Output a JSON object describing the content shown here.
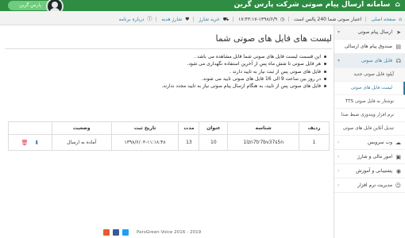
{
  "header": {
    "brand": "سامانه ارسال پیام صوتی شرکت پارس گرین",
    "user_label": "پارس گرین"
  },
  "crumbbar": {
    "home": "صفحه اصلی",
    "credit": "اعتبار صوتی شما 240 پالس است",
    "datetime": "۱۳۹۸/۶/۹-۱۷:۴۳:۱۷",
    "buy_credit": "خرید شارژ",
    "gift_credit": "شارژ هدیه",
    "about": "درباره برنامه"
  },
  "sidebar": {
    "items": [
      {
        "label": "ارسال پیام صوتی",
        "icon": "send-icon",
        "open": true
      },
      {
        "label": "صندوق پیام های ارسالی",
        "icon": "inbox-icon",
        "open": false
      },
      {
        "label": "فایل های صوتی",
        "icon": "headphones-icon",
        "open": true
      }
    ],
    "subitems": [
      "آپلود فایل صوتی جدید",
      "لیست فایل های صوتی",
      "نوشتار به فایل صوتی TTS",
      "نرم افزار ویندوزی ضبط صدا",
      "تبدیل آنلاین فایل های صوتی"
    ],
    "bottom_items": [
      {
        "label": "وب سرویس",
        "icon": "cloud-icon"
      },
      {
        "label": "امور مالی و شارژ",
        "icon": "wallet-icon"
      },
      {
        "label": "پشتیبانی و آموزش",
        "icon": "support-icon"
      },
      {
        "label": "مدیریت نرم افزار",
        "icon": "user-icon"
      }
    ]
  },
  "main": {
    "title": "لیست های فایل های صوتی شما",
    "info": [
      "این قسمت لیست فایل های صوتی شما قابل مشاهده می باشد .",
      "هر فایل صوتی تا شش ماه پس از آخرین استفاده نگهداری می شود.",
      "فایل های صوتی پس از ثبت نیاز به تایید دارند .",
      "در روز بین ساعت 9 الی 16 فایل های صوتی تایید می شوند.",
      "فایل های صوتی پس از تایید، به هنگام ارسال پیام صوتی نیاز به تایید مجدد ندارند."
    ],
    "table": {
      "headers": [
        "ردیف",
        "شناسه",
        "عنوان",
        "مدت",
        "تاریخ ثبت",
        "وضعیت",
        ""
      ],
      "rows": [
        {
          "index": "1",
          "id": "1lzn7tr7bv37s5n",
          "title": "10",
          "duration": "13",
          "date": "۱۳۹۸/۶/۰۳-۱۱:۱۸:۴۸",
          "status": "آماده به ارسال"
        }
      ]
    }
  },
  "footer": {
    "text": "ParsGreen Voice 2016 - 2019"
  },
  "colors": {
    "header": "#2e8c43",
    "accent": "#2e7ca0",
    "pill": "#6fcb7d"
  }
}
